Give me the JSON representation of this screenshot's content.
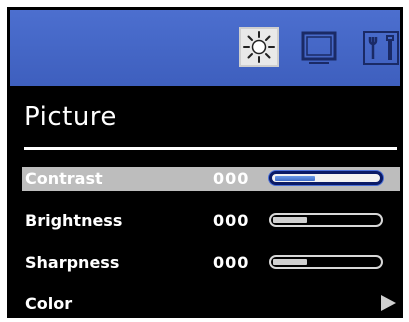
{
  "menu": {
    "title": "Picture",
    "tabs": [
      {
        "icon": "brightness-sun-icon",
        "selected": true
      },
      {
        "icon": "monitor-screen-icon",
        "selected": false
      },
      {
        "icon": "tools-icon",
        "selected": false
      }
    ],
    "items": [
      {
        "label": "Contrast",
        "value": "000",
        "level": 0.38,
        "selected": true
      },
      {
        "label": "Brightness",
        "value": "000",
        "level": 0.32,
        "selected": false
      },
      {
        "label": "Sharpness",
        "value": "000",
        "level": 0.32,
        "selected": false
      },
      {
        "label": "Color",
        "has_submenu": true,
        "selected": false
      }
    ]
  },
  "colors": {
    "header_blue": "#4567c8",
    "selection_gray": "#bdbdbd",
    "slider_fill_blue": "#4f7ed6"
  }
}
